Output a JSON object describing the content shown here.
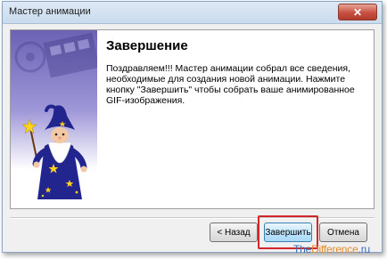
{
  "window": {
    "title": "Мастер анимации",
    "close_glyph": "✕"
  },
  "content": {
    "heading": "Завершение",
    "description": "Поздравляем!!! Мастер анимации собрал все сведения, необходимые для создания новой анимации. Нажмите кнопку \"Завершить\" чтобы собрать ваше анимированное GIF-изображения."
  },
  "buttons": {
    "back": "< Назад",
    "finish": "Завершить",
    "cancel": "Отмена"
  },
  "watermark": {
    "part1": "The",
    "part2": "Difference",
    "part3": ".ru"
  },
  "colors": {
    "highlight": "#d2262c",
    "watermark_blue": "#3a6fb6",
    "watermark_orange": "#e58a2a",
    "wizard_robe": "#23258e"
  },
  "icons": {
    "wizard": "wizard-illustration",
    "close": "close-icon"
  }
}
